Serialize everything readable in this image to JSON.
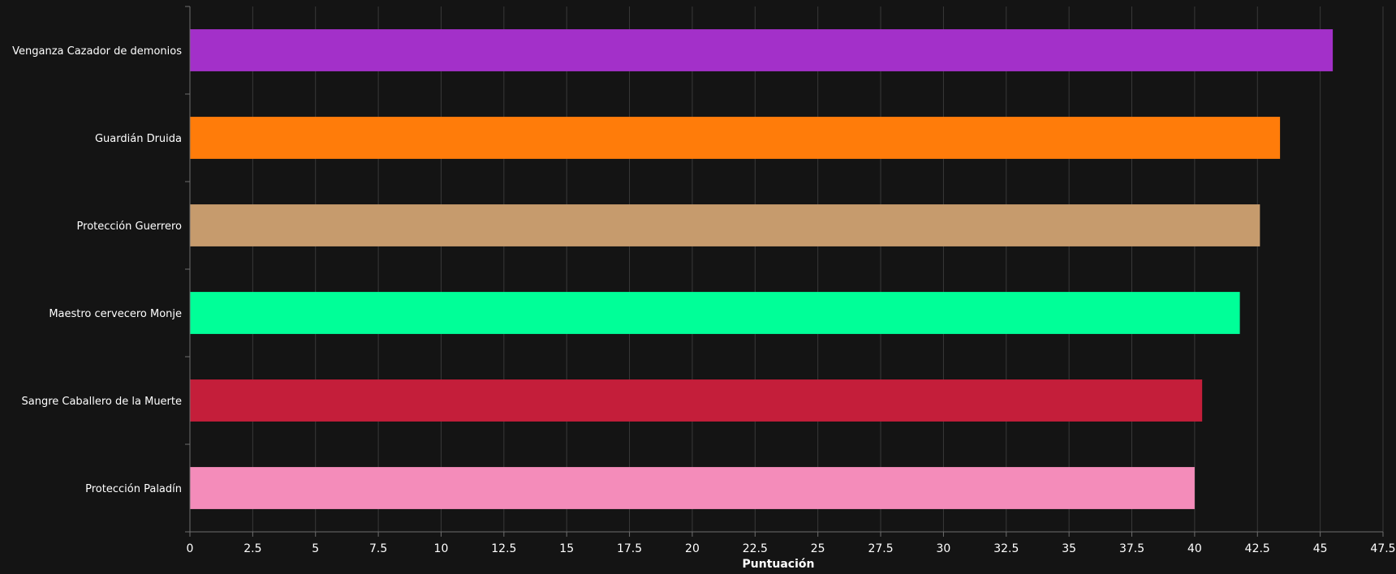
{
  "chart_data": {
    "type": "bar",
    "orientation": "horizontal",
    "title": "",
    "xlabel": "Puntuación",
    "ylabel": "",
    "xlim": [
      0,
      47.5
    ],
    "x_ticks": [
      "0",
      "2.5",
      "5",
      "7.5",
      "10",
      "12.5",
      "15",
      "17.5",
      "20",
      "22.5",
      "25",
      "27.5",
      "30",
      "32.5",
      "35",
      "37.5",
      "40",
      "42.5",
      "45",
      "47.5"
    ],
    "x_tick_values": [
      0,
      2.5,
      5,
      7.5,
      10,
      12.5,
      15,
      17.5,
      20,
      22.5,
      25,
      27.5,
      30,
      32.5,
      35,
      37.5,
      40,
      42.5,
      45,
      47.5
    ],
    "grid": true,
    "categories": [
      "Venganza Cazador de demonios",
      "Guardián Druida",
      "Protección Guerrero",
      "Maestro cervecero Monje",
      "Sangre Caballero de la Muerte",
      "Protección Paladín"
    ],
    "values": [
      45.5,
      43.4,
      42.6,
      41.8,
      40.3,
      40.0
    ],
    "colors": [
      "#a330c9",
      "#ff7c0a",
      "#c69b6d",
      "#00ff98",
      "#c41e3a",
      "#f48cba"
    ]
  },
  "colors": {
    "background": "#141414",
    "grid": "#3a3a3a",
    "axis": "#6e6e6e",
    "text": "#ffffff"
  }
}
